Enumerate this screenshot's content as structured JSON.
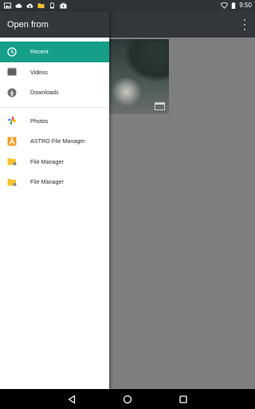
{
  "status_bar": {
    "time": "9:50",
    "icons": [
      "image-icon",
      "cloud-icon",
      "cloud-download-icon",
      "folder-icon",
      "phone-icon",
      "bag-icon",
      "wifi-icon",
      "battery-icon"
    ]
  },
  "drawer": {
    "title": "Open from",
    "items": [
      {
        "label": "Recent",
        "icon": "clock-icon",
        "selected": true
      },
      {
        "label": "Videos",
        "icon": "film-icon"
      },
      {
        "label": "Downloads",
        "icon": "download-icon"
      },
      {
        "label": "Photos",
        "icon": "pinwheel-icon"
      },
      {
        "label": "ASTRO File Manager",
        "icon": "astro-icon"
      },
      {
        "label": "File Manager",
        "icon": "folder-icon"
      },
      {
        "label": "File Manager",
        "icon": "folder-icon"
      }
    ]
  },
  "colors": {
    "accent": "#159f89",
    "toolbar": "#33373b",
    "scrim": "#7f7f7f"
  },
  "nav_bar": {
    "buttons": [
      "back-icon",
      "home-icon",
      "recents-icon"
    ]
  }
}
